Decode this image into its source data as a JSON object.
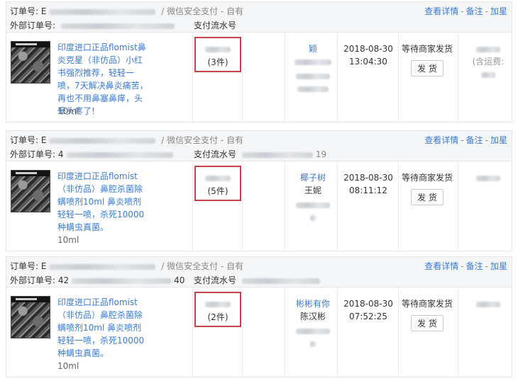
{
  "labels": {
    "order_no": "订单号:",
    "ext_order_no": "外部订单号:",
    "flow_no": "支付流水号",
    "pay_method": "/ 微信安全支付 - 自有",
    "view_detail": "查看详情",
    "remark": "备注",
    "star": "加星",
    "sep": "-",
    "ship": "发 货"
  },
  "orders": [
    {
      "order_prefix": "E",
      "ext_order_visible": "",
      "flow_visible": "",
      "product_name": "印度进口正品flomist鼻炎克星（非仿品）小红书强烈推荐，轻轻一喷，7天解决鼻炎痛苦，再也不用鼻塞鼻痒，头晕头疼了!",
      "spec": "10ml",
      "quantity": "(3件)",
      "buyer_nick": "颖",
      "buyer_name": "",
      "date": "2018-08-30",
      "time": "13:04:30",
      "status": "等待商家发货",
      "show_ship": true,
      "paid_note": "(含运费:"
    },
    {
      "order_prefix": "E",
      "ext_order_visible": "4",
      "flow_visible": "19",
      "product_name": "印度进口正品flomist（非仿品）鼻腔杀菌除螨喷剂10ml 鼻炎喷剂 轻轻一喷，杀死10000种螨虫真菌。",
      "spec": "10ml",
      "quantity": "(5件)",
      "buyer_nick": "椰子树",
      "buyer_name": "王妮",
      "date": "2018-08-30",
      "time": "08:11:12",
      "status": "等待商家发货",
      "show_ship": true,
      "paid_note": ""
    },
    {
      "order_prefix": "E",
      "ext_order_visible": "42",
      "flow_visible": "40",
      "product_name": "印度进口正品flomist（非仿品）鼻腔杀菌除螨喷剂10ml 鼻炎喷剂 轻轻一喷，杀死10000种螨虫真菌。",
      "spec": "10ml",
      "quantity": "(2件)",
      "buyer_nick": "彬彬有你",
      "buyer_name": "陈汉彬",
      "date": "2018-08-30",
      "time": "07:52:25",
      "status": "等待商家发货",
      "show_ship": true,
      "paid_note": ""
    }
  ]
}
